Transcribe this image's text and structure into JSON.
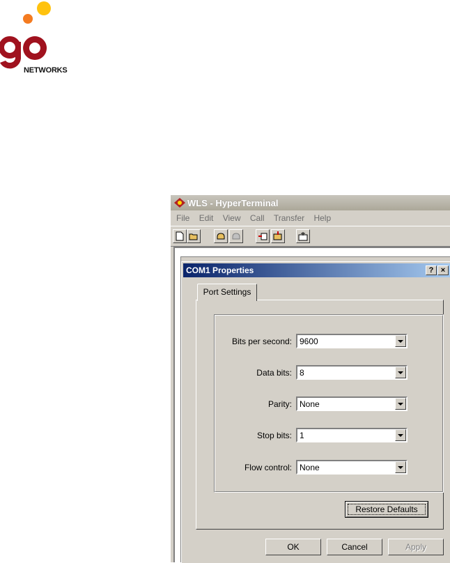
{
  "logo": {
    "sub_text": "NETWORKS"
  },
  "window": {
    "title": "WLS - HyperTerminal",
    "menu": [
      "File",
      "Edit",
      "View",
      "Call",
      "Transfer",
      "Help"
    ]
  },
  "dialog": {
    "title": "COM1 Properties",
    "help_btn": "?",
    "close_btn": "×",
    "tab": "Port Settings",
    "fields": {
      "bits_per_second": {
        "label": "Bits per second:",
        "value": "9600"
      },
      "data_bits": {
        "label": "Data bits:",
        "value": "8"
      },
      "parity": {
        "label": "Parity:",
        "value": "None"
      },
      "stop_bits": {
        "label": "Stop bits:",
        "value": "1"
      },
      "flow_control": {
        "label": "Flow control:",
        "value": "None"
      }
    },
    "restore_defaults": "Restore Defaults",
    "ok": "OK",
    "cancel": "Cancel",
    "apply": "Apply"
  },
  "colors": {
    "logo_red": "#a0121e",
    "logo_orange": "#f47b20",
    "logo_yellow": "#ffc20e",
    "dialog_title_start": "#0a246a",
    "dialog_title_end": "#a6caf0"
  }
}
